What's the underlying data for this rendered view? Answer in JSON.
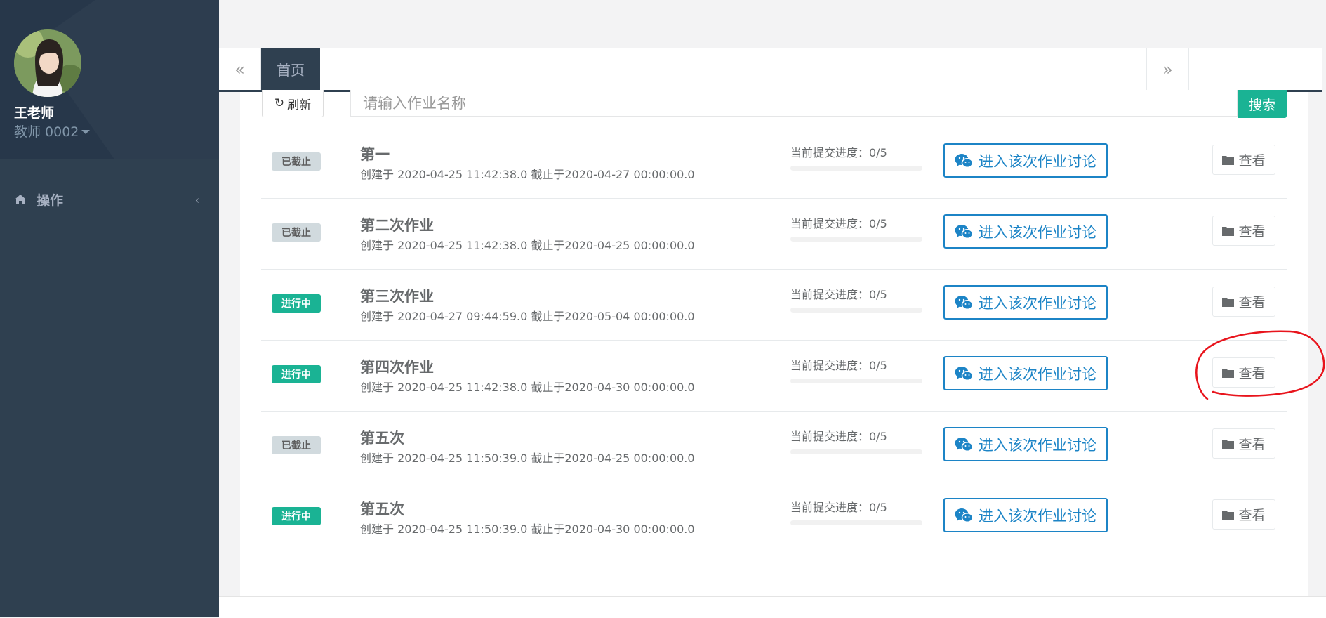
{
  "sidebar": {
    "user_name": "王老师",
    "user_role": "教师 0002",
    "nav": {
      "label": "操作"
    },
    "icons": {
      "home": "home-icon",
      "expand": "chevron-left-icon",
      "role_menu": "caret-down-icon"
    }
  },
  "tabs": {
    "prev_symbol": "«",
    "next_symbol": "»",
    "items": [
      {
        "label": "首页"
      }
    ]
  },
  "toolbar": {
    "refresh_label": "刷新",
    "refresh_icon": "↻",
    "search_placeholder": "请输入作业名称",
    "search_value": "",
    "search_label": "搜索"
  },
  "assignments": [
    {
      "status": "已截止",
      "status_type": "closed",
      "title": "第一",
      "meta": "创建于 2020-04-25 11:42:38.0 截止于2020-04-27 00:00:00.0",
      "progress_label": "当前提交进度：0/5",
      "progress": 0,
      "discuss_label": "进入该次作业讨论",
      "view_label": "查看"
    },
    {
      "status": "已截止",
      "status_type": "closed",
      "title": "第二次作业",
      "meta": "创建于 2020-04-25 11:42:38.0 截止于2020-04-25 00:00:00.0",
      "progress_label": "当前提交进度：0/5",
      "progress": 0,
      "discuss_label": "进入该次作业讨论",
      "view_label": "查看"
    },
    {
      "status": "进行中",
      "status_type": "active",
      "title": "第三次作业",
      "meta": "创建于 2020-04-27 09:44:59.0 截止于2020-05-04 00:00:00.0",
      "progress_label": "当前提交进度：0/5",
      "progress": 0,
      "discuss_label": "进入该次作业讨论",
      "view_label": "查看"
    },
    {
      "status": "进行中",
      "status_type": "active",
      "title": "第四次作业",
      "meta": "创建于 2020-04-25 11:42:38.0 截止于2020-04-30 00:00:00.0",
      "progress_label": "当前提交进度：0/5",
      "progress": 0,
      "discuss_label": "进入该次作业讨论",
      "view_label": "查看"
    },
    {
      "status": "已截止",
      "status_type": "closed",
      "title": "第五次",
      "meta": "创建于 2020-04-25 11:50:39.0 截止于2020-04-25 00:00:00.0",
      "progress_label": "当前提交进度：0/5",
      "progress": 0,
      "discuss_label": "进入该次作业讨论",
      "view_label": "查看"
    },
    {
      "status": "进行中",
      "status_type": "active",
      "title": "第五次",
      "meta": "创建于 2020-04-25 11:50:39.0 截止于2020-04-30 00:00:00.0",
      "progress_label": "当前提交进度：0/5",
      "progress": 0,
      "discuss_label": "进入该次作业讨论",
      "view_label": "查看"
    }
  ],
  "colors": {
    "sidebar_bg": "#2f4050",
    "primary": "#1ab394",
    "info": "#1c84c6",
    "annotation": "#e8141c"
  },
  "annotation": {
    "shape": "freehand-circle",
    "target": "assignment-4-view-button"
  }
}
